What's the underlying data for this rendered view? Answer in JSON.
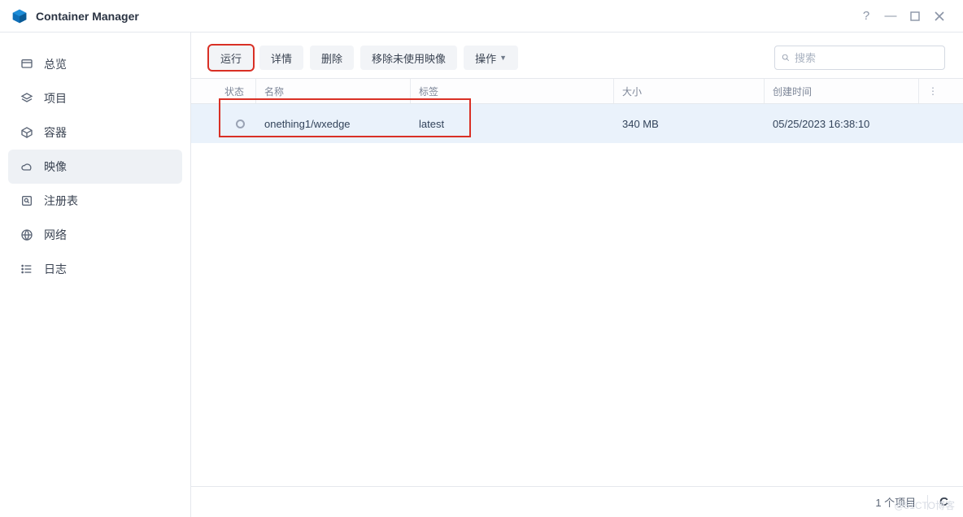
{
  "app": {
    "title": "Container Manager"
  },
  "sidebar": {
    "items": [
      {
        "label": "总览"
      },
      {
        "label": "项目"
      },
      {
        "label": "容器"
      },
      {
        "label": "映像"
      },
      {
        "label": "注册表"
      },
      {
        "label": "网络"
      },
      {
        "label": "日志"
      }
    ],
    "selected_index": 3
  },
  "toolbar": {
    "run": "运行",
    "detail": "详情",
    "delete": "删除",
    "prune": "移除未使用映像",
    "action": "操作"
  },
  "search": {
    "placeholder": "搜索"
  },
  "columns": {
    "status": "状态",
    "name": "名称",
    "tag": "标签",
    "size": "大小",
    "time": "创建时间"
  },
  "rows": [
    {
      "name": "onething1/wxedge",
      "tag": "latest",
      "size": "340 MB",
      "time": "05/25/2023 16:38:10"
    }
  ],
  "footer": {
    "count_label": "1 个项目"
  },
  "watermark": "@51CTO博客"
}
